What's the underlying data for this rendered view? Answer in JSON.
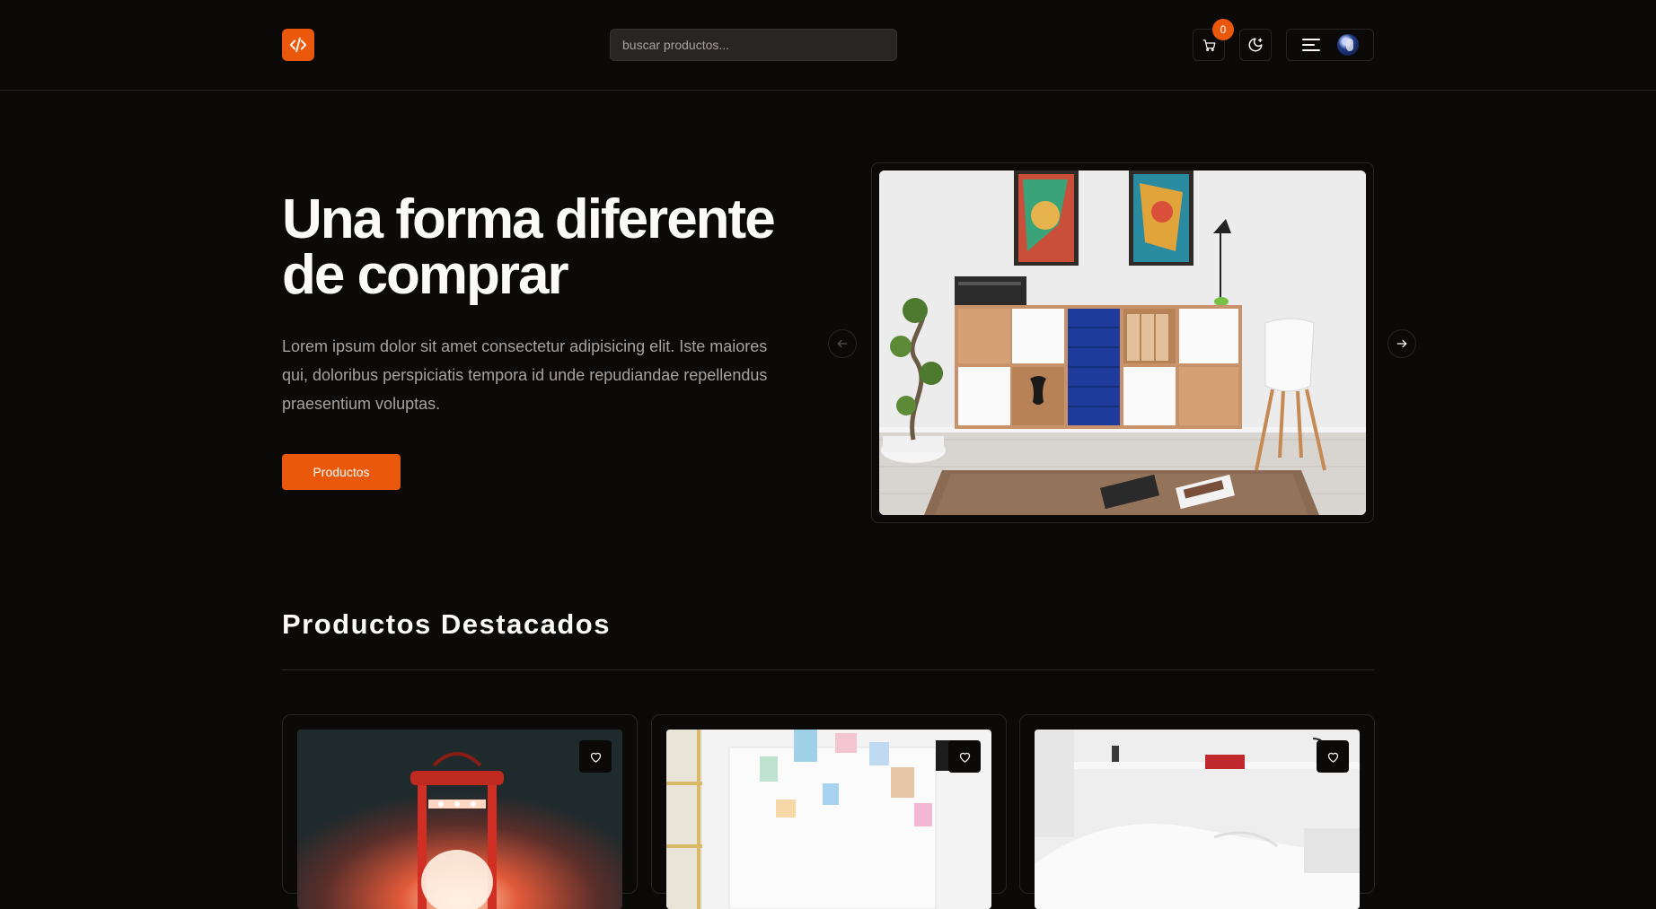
{
  "header": {
    "search_placeholder": "buscar productos...",
    "cart_count": "0",
    "accent_color": "#ea580c"
  },
  "hero": {
    "title": "Una forma diferente de comprar",
    "text": "Lorem ipsum dolor sit amet consectetur adipisicing elit. Iste maiores qui, doloribus perspiciatis tempora id unde repudiandae repellendus praesentium voluptas.",
    "cta_label": "Productos"
  },
  "featured": {
    "title": "Productos Destacados",
    "products": [
      {
        "image": "red-lantern-photo"
      },
      {
        "image": "pinboard-desk-photo"
      },
      {
        "image": "white-bedroom-photo"
      }
    ]
  },
  "icons": {
    "logo": "code-icon",
    "cart": "cart-icon",
    "theme": "moon-icon",
    "menu": "menu-icon",
    "prev": "arrow-left-icon",
    "next": "arrow-right-icon",
    "favorite": "heart-icon"
  }
}
